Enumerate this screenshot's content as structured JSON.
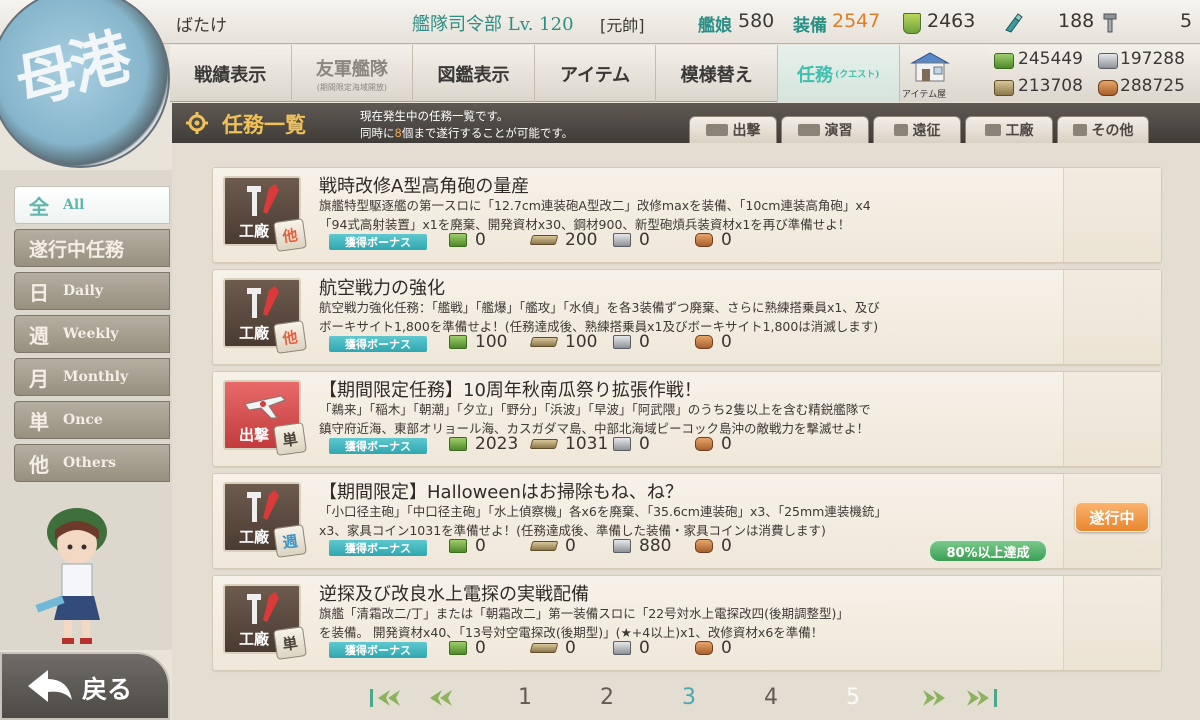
{
  "header": {
    "player_name": "ばたけ",
    "hq_title": "艦隊司令部",
    "hq_level": "Lv. 120",
    "rank": "[元帥]",
    "ship_label": "艦娘",
    "ship_count": "580",
    "equip_label": "装備",
    "equip_count": "2547",
    "bucket_count": "2463",
    "torch_count": "188",
    "screw_count": "5"
  },
  "emblem_text": "母港",
  "nav": {
    "items": [
      {
        "label": "戦績表示",
        "sub": ""
      },
      {
        "label": "友軍艦隊",
        "sub": "(期間限定海域開放)"
      },
      {
        "label": "図鑑表示",
        "sub": ""
      },
      {
        "label": "アイテム",
        "sub": ""
      },
      {
        "label": "模様替え",
        "sub": ""
      },
      {
        "label": "任務",
        "sub": "(クエスト)"
      }
    ],
    "item_store_label": "アイテム屋"
  },
  "resources": {
    "fuel": "245449",
    "steel": "197288",
    "ammo": "213708",
    "bauxite": "288725"
  },
  "filters": [
    {
      "kanji": "全",
      "en": "All"
    },
    {
      "kanji": "遂行中任務",
      "en": ""
    },
    {
      "kanji": "日",
      "en": "Daily"
    },
    {
      "kanji": "週",
      "en": "Weekly"
    },
    {
      "kanji": "月",
      "en": "Monthly"
    },
    {
      "kanji": "単",
      "en": "Once"
    },
    {
      "kanji": "他",
      "en": "Others"
    }
  ],
  "back_label": "戻る",
  "section": {
    "title": "任務一覧",
    "desc1": "現在発生中の任務一覧です。",
    "desc2_pre": "同時に",
    "desc2_num": "8",
    "desc2_post": "個まで遂行することが可能です。"
  },
  "categories": [
    "出撃",
    "演習",
    "遠征",
    "工廠",
    "その他"
  ],
  "bonus_label": "獲得ボーナス",
  "quests": [
    {
      "category": "工廠",
      "type": "他",
      "title": "戦時改修A型高角砲の量産",
      "desc1": "旗艦特型駆逐艦の第一スロに「12.7cm連装砲A型改二」改修maxを装備、「10cm連装高角砲」x4",
      "desc2": "「94式高射装置」x1を廃棄、開発資材x30、鋼材900、新型砲熕兵装資材x1を再び準備せよ！",
      "fuel": "0",
      "ammo": "200",
      "steel": "0",
      "bauxite": "0",
      "status": "",
      "progress": ""
    },
    {
      "category": "工廠",
      "type": "他",
      "title": "航空戦力の強化",
      "desc1": "航空戦力強化任務：「艦戦」「艦爆」「艦攻」「水偵」を各3装備ずつ廃棄、さらに熟練搭乗員x1、及び",
      "desc2": "ボーキサイト1,800を準備せよ！(任務達成後、熟練搭乗員x1及びボーキサイト1,800は消滅します)",
      "fuel": "100",
      "ammo": "100",
      "steel": "0",
      "bauxite": "0",
      "status": "",
      "progress": ""
    },
    {
      "category": "出撃",
      "type": "単",
      "title": "【期間限定任務】10周年秋南瓜祭り拡張作戦！",
      "desc1": "「鵜来」「稲木」「朝潮」「夕立」「野分」「浜波」「早波」「阿武隈」のうち2隻以上を含む精鋭艦隊で",
      "desc2": "鎮守府近海、東部オリョール海、カスガダマ島、中部北海域ピーコック島沖の敵戦力を撃滅せよ！",
      "fuel": "2023",
      "ammo": "1031",
      "steel": "0",
      "bauxite": "0",
      "status": "",
      "progress": ""
    },
    {
      "category": "工廠",
      "type": "週",
      "title": "【期間限定】Halloweenはお掃除もね、ね？",
      "desc1": "「小口径主砲」「中口径主砲」「水上偵察機」各x6を廃棄、「35.6cm連装砲」x3、「25mm連装機銃」",
      "desc2": "x3、家具コイン1031を準備せよ！(任務達成後、準備した装備・家具コインは消費します)",
      "fuel": "0",
      "ammo": "0",
      "steel": "880",
      "bauxite": "0",
      "status": "遂行中",
      "progress": "80%以上達成"
    },
    {
      "category": "工廠",
      "type": "単",
      "title": "逆探及び改良水上電探の実戦配備",
      "desc1": "旗艦「清霜改二/丁」または「朝霜改二」第一装備スロに「22号対水上電探改四(後期調整型)」",
      "desc2": "を装備。 開発資材x40、「13号対空電探改(後期型)」(★+4以上)x1、改修資材x6を準備！",
      "fuel": "0",
      "ammo": "0",
      "steel": "0",
      "bauxite": "0",
      "status": "",
      "progress": ""
    }
  ],
  "pagination": {
    "pages": [
      "1",
      "2",
      "3",
      "4",
      "5"
    ],
    "current": "3"
  },
  "colors": {
    "accent_teal": "#3fbfae",
    "header_gold": "#f0c15a",
    "equip_orange": "#e07d28",
    "in_progress_orange": "#f39a45",
    "progress_green": "#3a9e52"
  }
}
